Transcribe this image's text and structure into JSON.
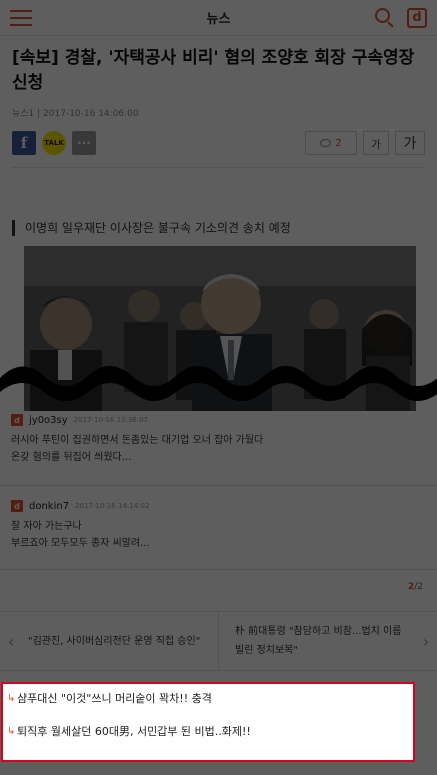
{
  "header": {
    "title": "뉴스",
    "menu_icon": "hamburger-menu-icon",
    "search_icon": "search-icon",
    "logo_letter": "d",
    "accent_color": "#e0502a"
  },
  "article": {
    "headline": "[속보] 경찰, '자택공사 비리' 혐의 조양호 회장 구속영장 신청",
    "byline": "뉴스1 | 2017-10-16 14:06:00",
    "share": {
      "facebook_label": "f",
      "kakao_label": "TALK",
      "more_label": "···"
    },
    "comment_count": "2",
    "font_small_label": "가",
    "font_large_label": "가",
    "subtitle": "이명희 일우재단 이사장은 불구속 기소의견 송치 예정"
  },
  "comments": [
    {
      "user": "jy0o3sy",
      "date": "2017-10-16 13:36:07",
      "text_line1": "러시아 푸틴이 집권하면서 돈좀있는 대기업 오너 잡아 가뒀다",
      "text_line2": "온갖 혐의를 뒤집어 씌웠다..."
    },
    {
      "user": "donkin7",
      "date": "2017-10-16 14:14:02",
      "text_line1": "잘 자아 가는구나",
      "text_line2": "부르죠아 모두모두 종자 씨말려..."
    }
  ],
  "pager": {
    "current": "2",
    "separator": "/",
    "total": "2"
  },
  "related": {
    "prev_arrow": "‹",
    "prev_text": "\"김관진, 사이버심리전단 운영 직접 승인\"",
    "next_text": "朴 前대통령 \"참담하고 비참...법치 이름 빌린 정치보복\"",
    "next_arrow": "›"
  },
  "promo": {
    "arrow_glyph": "↳",
    "items": [
      "샴푸대신 \"이것\"쓰니 머리숱이 꽉차!! 충격",
      "퇴직후 월세살던 60대男, 서민갑부 된 비법..화제!!"
    ],
    "border_color": "#d9001b"
  }
}
